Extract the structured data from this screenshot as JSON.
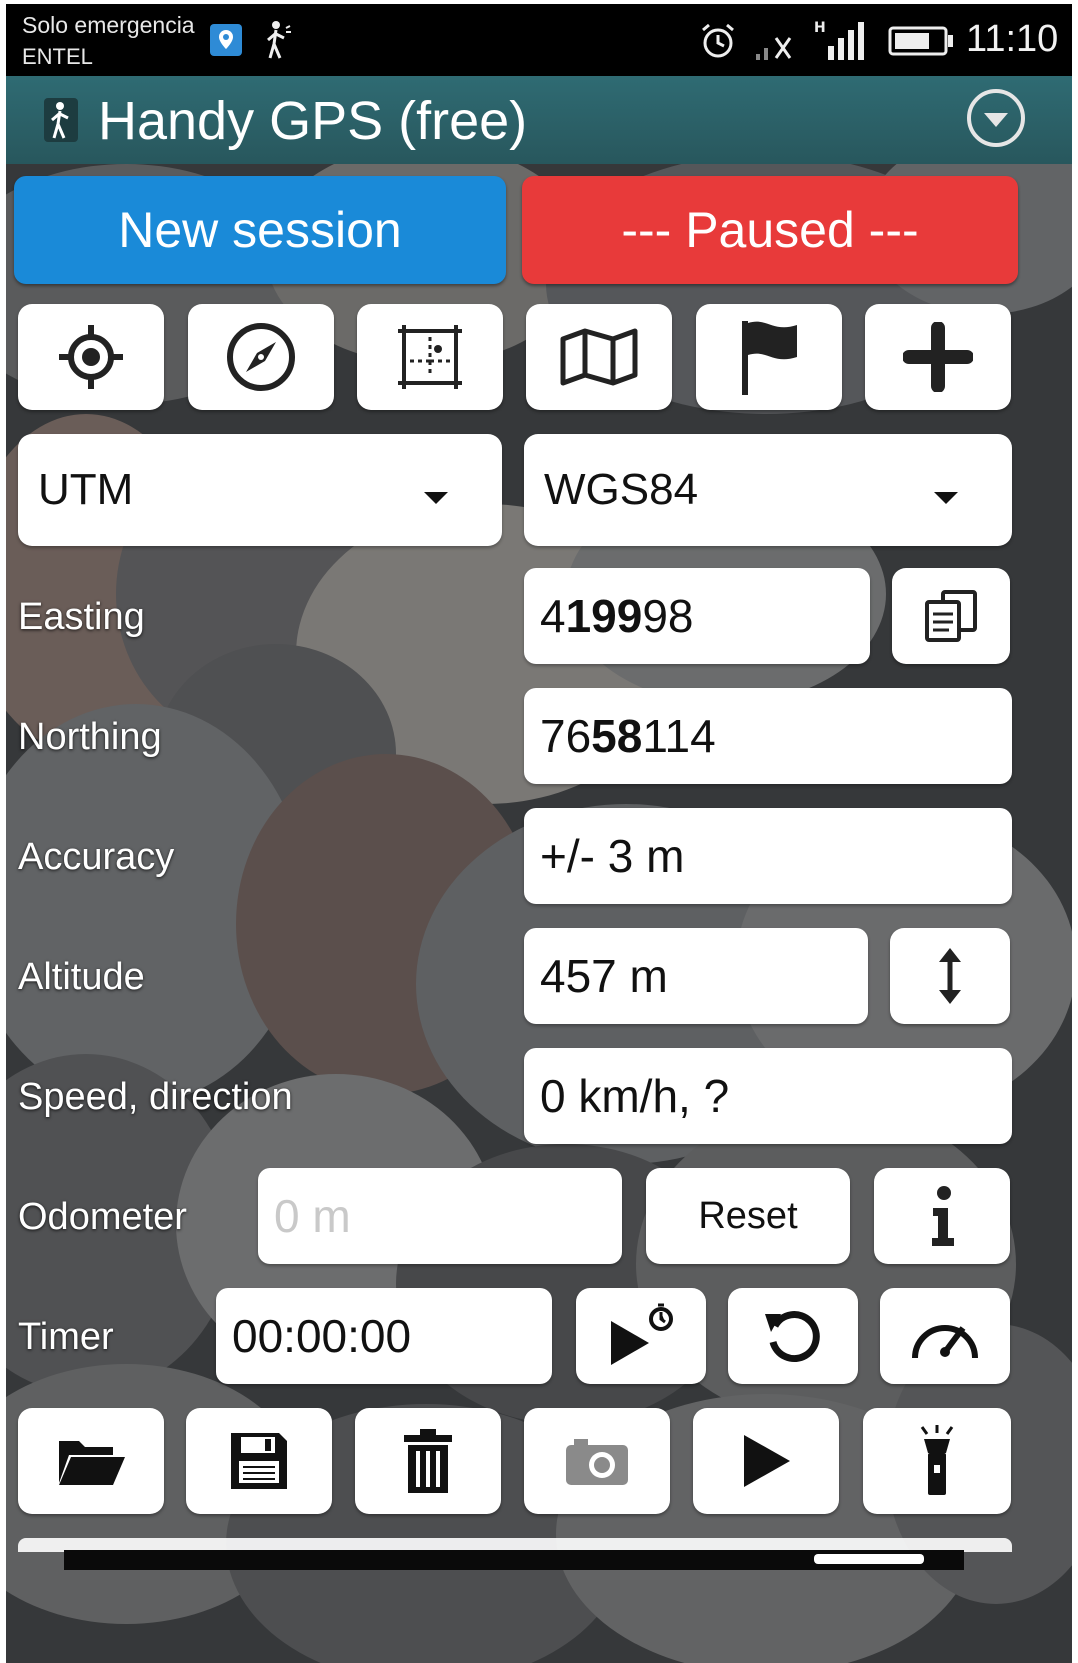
{
  "status_bar": {
    "carrier_line1": "Solo emergencia",
    "carrier_line2": "ENTEL",
    "time": "11:10"
  },
  "app_bar": {
    "title": "Handy GPS (free)"
  },
  "session": {
    "new_session_label": "New session",
    "status_label": "--- Paused ---",
    "new_session_color": "#1a8ad8",
    "paused_color": "#e83a3a"
  },
  "toolbar_top": {
    "icons": [
      "crosshair-icon",
      "compass-icon",
      "grid-icon",
      "map-icon",
      "flag-icon",
      "plus-icon"
    ]
  },
  "coordinates": {
    "format": "UTM",
    "datum": "WGS84"
  },
  "readouts": {
    "easting_label": "Easting",
    "easting_value_a": "4",
    "easting_value_bold": "199",
    "easting_value_b": "98",
    "northing_label": "Northing",
    "northing_value_a": "76",
    "northing_value_bold": "58",
    "northing_value_b": "114",
    "accuracy_label": "Accuracy",
    "accuracy_value": "+/- 3 m",
    "altitude_label": "Altitude",
    "altitude_value": "457 m",
    "speed_label": "Speed, direction",
    "speed_value": "0 km/h, ?"
  },
  "odometer": {
    "label": "Odometer",
    "placeholder": "0 m",
    "reset_label": "Reset"
  },
  "timer": {
    "label": "Timer",
    "value": "00:00:00"
  },
  "toolbar_bottom": {
    "icons": [
      "folder-icon",
      "save-icon",
      "trash-icon",
      "camera-icon",
      "play-icon",
      "flashlight-icon"
    ]
  }
}
